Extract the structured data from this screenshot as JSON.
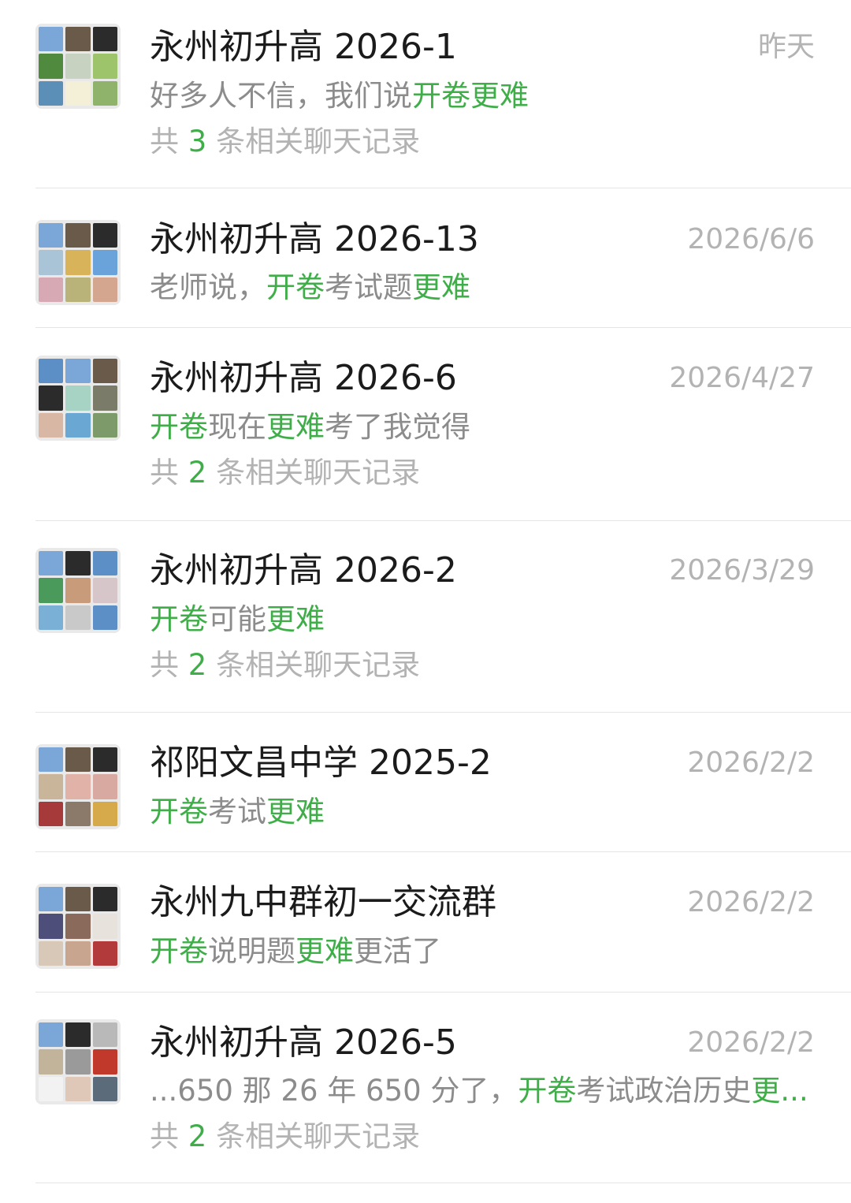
{
  "colors": {
    "highlight": "#3fae49",
    "secondary_text": "#8c8c8c",
    "meta_text": "#b3b3b3",
    "divider": "#e5e5e5"
  },
  "results": [
    {
      "title": "永州初升高 2026-1",
      "time": "昨天",
      "avatar_icon": "group-avatar-icon",
      "snippet": [
        {
          "text": "好多人不信，我们说",
          "hl": false
        },
        {
          "text": "开卷更难",
          "hl": true
        }
      ],
      "count": {
        "prefix": "共",
        "num": "3",
        "suffix": "条相关聊天记录"
      }
    },
    {
      "title": "永州初升高 2026-13",
      "time": "2026/6/6",
      "avatar_icon": "group-avatar-icon",
      "snippet": [
        {
          "text": "老师说，",
          "hl": false
        },
        {
          "text": "开卷",
          "hl": true
        },
        {
          "text": "考试题",
          "hl": false
        },
        {
          "text": "更难",
          "hl": true
        }
      ],
      "count": null
    },
    {
      "title": "永州初升高 2026-6",
      "time": "2026/4/27",
      "avatar_icon": "group-avatar-icon",
      "snippet": [
        {
          "text": "开卷",
          "hl": true
        },
        {
          "text": "现在",
          "hl": false
        },
        {
          "text": "更难",
          "hl": true
        },
        {
          "text": "考了我觉得",
          "hl": false
        }
      ],
      "count": {
        "prefix": "共",
        "num": "2",
        "suffix": "条相关聊天记录"
      }
    },
    {
      "title": "永州初升高 2026-2",
      "time": "2026/3/29",
      "avatar_icon": "group-avatar-icon",
      "snippet": [
        {
          "text": "开卷",
          "hl": true
        },
        {
          "text": "可能",
          "hl": false
        },
        {
          "text": "更难",
          "hl": true
        }
      ],
      "count": {
        "prefix": "共",
        "num": "2",
        "suffix": "条相关聊天记录"
      }
    },
    {
      "title": "祁阳文昌中学 2025-2",
      "time": "2026/2/2",
      "avatar_icon": "group-avatar-icon",
      "snippet": [
        {
          "text": "开卷",
          "hl": true
        },
        {
          "text": "考试",
          "hl": false
        },
        {
          "text": "更难",
          "hl": true
        }
      ],
      "count": null
    },
    {
      "title": "永州九中群初一交流群",
      "time": "2026/2/2",
      "avatar_icon": "group-avatar-icon",
      "snippet": [
        {
          "text": "开卷",
          "hl": true
        },
        {
          "text": "说明题",
          "hl": false
        },
        {
          "text": "更难",
          "hl": true
        },
        {
          "text": "更活了",
          "hl": false
        }
      ],
      "count": null
    },
    {
      "title": "永州初升高 2026-5",
      "time": "2026/2/2",
      "avatar_icon": "group-avatar-icon",
      "snippet": [
        {
          "text": "...650 那 26 年 650 分了，",
          "hl": false
        },
        {
          "text": "开卷",
          "hl": true
        },
        {
          "text": "考试政治历史",
          "hl": false
        },
        {
          "text": "更...",
          "hl": true
        }
      ],
      "count": {
        "prefix": "共",
        "num": "2",
        "suffix": "条相关聊天记录"
      }
    }
  ]
}
